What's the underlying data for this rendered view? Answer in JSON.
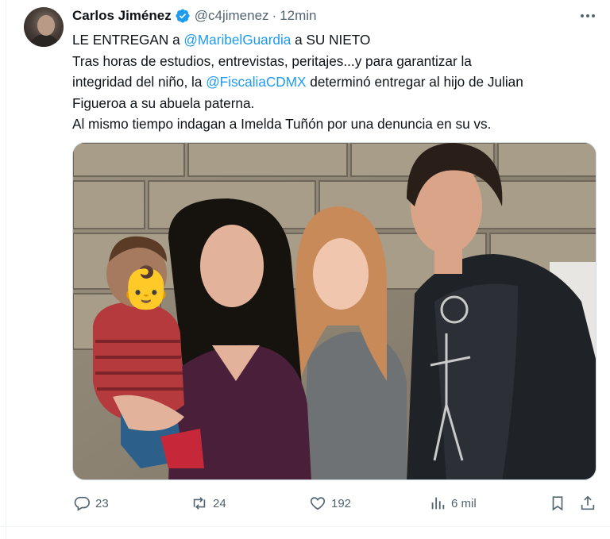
{
  "author": {
    "name": "Carlos Jiménez",
    "handle": "@c4jimenez",
    "separator": "·",
    "time": "12min"
  },
  "tweet": {
    "line1": {
      "a": "LE ENTREGAN a ",
      "mention": "@MaribelGuardia",
      "b": " a SU NIETO"
    },
    "line2": "Tras horas de estudios, entrevistas, peritajes...y para garantizar la",
    "line3": {
      "a": "integridad del niño, la ",
      "mention": "@FiscaliaCDMX",
      "b": " determinó entregar al hijo de Julian"
    },
    "line4": "Figueroa a su abuela paterna.",
    "line5": "Al mismo tiempo indagan a Imelda Tuñón por una denuncia en su vs."
  },
  "media": {
    "emoji": "👶"
  },
  "actions": {
    "replies": "23",
    "reposts": "24",
    "likes": "192",
    "views": "6 mil"
  },
  "colors": {
    "accent": "#1d9bf0",
    "text": "#0f1419",
    "muted": "#536471"
  },
  "icons": [
    "verified-badge-icon",
    "more-icon",
    "reply-icon",
    "repost-icon",
    "like-icon",
    "views-icon",
    "bookmark-icon",
    "share-icon"
  ]
}
